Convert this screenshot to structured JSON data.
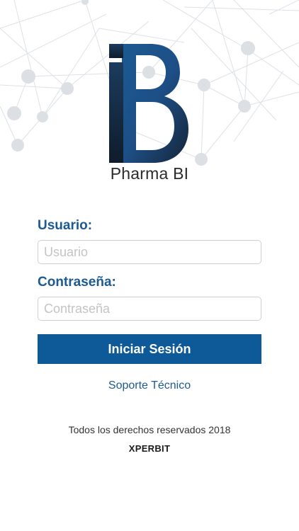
{
  "brand": {
    "logo": "iB-logo",
    "name": "Pharma BI"
  },
  "login": {
    "username_label": "Usuario:",
    "username_placeholder": "Usuario",
    "password_label": "Contraseña:",
    "password_placeholder": "Contraseña",
    "submit_label": "Iniciar Sesión"
  },
  "support": {
    "link_label": "Soporte Técnico"
  },
  "footer": {
    "copyright": "Todos los derechos reservados 2018",
    "company": "XPERBIT"
  },
  "colors": {
    "accent": "#0e5a98",
    "label": "#1d5a92",
    "network": "#d9dde3"
  }
}
